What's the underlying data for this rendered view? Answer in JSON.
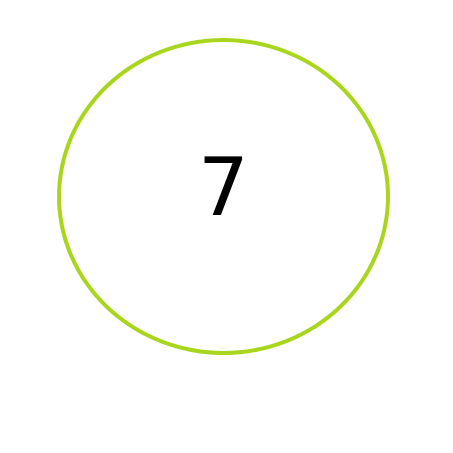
{
  "number": "7",
  "colors": {
    "ring": "#a8d61c",
    "text": "#000000",
    "background": "#ffffff"
  }
}
